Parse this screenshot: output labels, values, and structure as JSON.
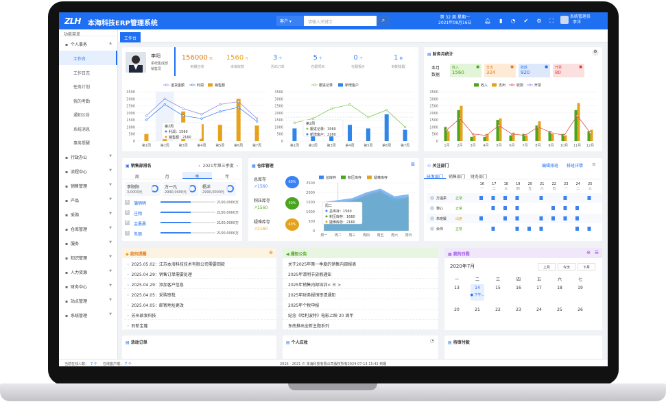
{
  "app": {
    "title": "本海科技ERP管理系统",
    "logo": "ZLH"
  },
  "search": {
    "select_label": "客户",
    "placeholder": "请输入关键字",
    "button_icon": "search-icon"
  },
  "header": {
    "week_line": "第 32 周 星期一",
    "date": "2021年08月16日",
    "user_name": "系统管理员",
    "user_sub": "李洋"
  },
  "sidebar": {
    "header": "功能菜单",
    "groups": [
      {
        "label": "个人事务",
        "icon": "person-icon",
        "expanded": true
      },
      {
        "label": "行政办公",
        "icon": "office-icon"
      },
      {
        "label": "流程中心",
        "icon": "flow-icon"
      },
      {
        "label": "销售管理",
        "icon": "sales-icon"
      },
      {
        "label": "产品",
        "icon": "product-icon"
      },
      {
        "label": "采购",
        "icon": "cart-icon"
      },
      {
        "label": "仓库管理",
        "icon": "warehouse-icon"
      },
      {
        "label": "服务",
        "icon": "service-icon"
      },
      {
        "label": "知识管理",
        "icon": "book-icon"
      },
      {
        "label": "人力资源",
        "icon": "people-icon"
      },
      {
        "label": "财务中心",
        "icon": "money-icon"
      },
      {
        "label": "站点管理",
        "icon": "site-icon"
      },
      {
        "label": "系统管理",
        "icon": "gear-icon"
      }
    ],
    "subitems": [
      "工作台",
      "工作日志",
      "任务计划",
      "我的考勤",
      "通知公告",
      "系统消息",
      "事务提醒"
    ]
  },
  "tabs": [
    "工作台"
  ],
  "profile": {
    "name": "李阳",
    "dept": "系统集成部",
    "role": "销售员"
  },
  "stats": [
    {
      "value": "156000",
      "unit": "元",
      "label": "到期应收",
      "color": "#e57a18"
    },
    {
      "value": "1560",
      "unit": "元",
      "label": "未销收款",
      "color": "#e5a21c"
    },
    {
      "value": "3",
      "unit": "个",
      "label": "活动订单",
      "color": "#3a82f4"
    },
    {
      "value": "5",
      "unit": "个",
      "label": "在跟项目",
      "color": "#3a82f4"
    },
    {
      "value": "0",
      "unit": "个",
      "label": "在跟报价",
      "color": "#3a82f4"
    },
    {
      "value": "1",
      "unit": "条",
      "label": "到期提醒",
      "color": "#3a82f4"
    }
  ],
  "chart_left": {
    "legend": [
      "退货金额",
      "利润",
      "销售额"
    ],
    "categories": [
      "第1周",
      "第2周",
      "第3周",
      "第4周",
      "第5周",
      "第6周",
      "第7周"
    ],
    "ylim": [
      0,
      3500
    ],
    "yticks": [
      0,
      500,
      1000,
      1500,
      2000,
      2500,
      3000,
      3500
    ],
    "bars": [
      500,
      1000,
      2100,
      1200,
      1150,
      3000,
      1100
    ],
    "line1": [
      1800,
      3000,
      2300,
      1900,
      2600,
      2800,
      1600
    ],
    "line2": [
      1500,
      2600,
      1800,
      1600,
      2100,
      2400,
      1400
    ],
    "tooltip": {
      "title": "第2周",
      "rows": [
        "利润：1560",
        "销售额：2160"
      ]
    }
  },
  "chart_mid": {
    "legend": [
      "跟进记录",
      "新增客户"
    ],
    "categories": [
      "第1周",
      "第2周",
      "第3周",
      "第4周",
      "第5周",
      "第6周",
      "第7周"
    ],
    "ylim": [
      0,
      3500
    ],
    "yticks": [
      0,
      500,
      1000,
      1500,
      2000,
      2500,
      3000,
      3500
    ],
    "bars": [
      900,
      1100,
      1400,
      1150,
      900,
      1900,
      800
    ],
    "line": [
      1300,
      1600,
      2300,
      2600,
      1700,
      2200,
      1000
    ],
    "tooltip": {
      "title": "第2周",
      "rows": [
        "跟进记录：1560",
        "新增客户：2160"
      ]
    }
  },
  "finance": {
    "title": "财务月统计",
    "period": [
      "本月",
      "数据"
    ],
    "kpis": [
      {
        "label": "收入",
        "value": "1560",
        "color": "#49a51d",
        "bg": "#e3f5d8"
      },
      {
        "label": "支出",
        "value": "324",
        "color": "#e57a18",
        "bg": "#fdebd7"
      },
      {
        "label": "收款",
        "value": "920",
        "color": "#1e6ff2",
        "bg": "#dde8fb"
      },
      {
        "label": "开票",
        "value": "80",
        "color": "#e23b3b",
        "bg": "#fbe0e0"
      }
    ],
    "legend": [
      "收入",
      "支出",
      "收款",
      "开票"
    ],
    "categories": [
      "1月",
      "2月",
      "3月",
      "4月",
      "5月",
      "6月",
      "7月",
      "8月",
      "9月",
      "10月",
      "11月",
      "12月"
    ],
    "ylim": [
      0,
      3500
    ],
    "yticks": [
      0,
      500,
      1000,
      1500,
      2000,
      2500,
      3000,
      3500
    ],
    "income": [
      1000,
      2200,
      300,
      300,
      1500,
      400,
      500,
      1100,
      700,
      500,
      2200,
      700
    ],
    "expense": [
      700,
      2500,
      400,
      500,
      1600,
      600,
      400,
      1400,
      500,
      400,
      2700,
      800
    ],
    "collect": [
      800,
      1600,
      500,
      400,
      1100,
      500,
      400,
      1000,
      600,
      400,
      1800,
      600
    ]
  },
  "sales_rank": {
    "title": "销售部排名",
    "year": "2021年第三季度",
    "tabs": [
      "周",
      "月",
      "季",
      "年"
    ],
    "active_tab": "季",
    "top": [
      {
        "name": "李阳阳",
        "value": "3,0000元"
      },
      {
        "name": "方一凡",
        "value": "2990,0000元"
      },
      {
        "name": "杨洋",
        "value": "2990,0000元"
      }
    ],
    "rows": [
      {
        "rank": "4",
        "name": "蒲明明",
        "value": "2100,0000万",
        "pct": 0.55
      },
      {
        "rank": "5",
        "name": "庄翔",
        "value": "2100,0000万",
        "pct": 0.55
      },
      {
        "rank": "6",
        "name": "金晨晨",
        "value": "2100,0000万",
        "pct": 0.55
      },
      {
        "rank": "7",
        "name": "朱丽",
        "value": "2100,0000万",
        "pct": 0.55
      }
    ]
  },
  "warehouse": {
    "title": "仓库管理",
    "items": [
      {
        "label": "总库存",
        "value": "1560",
        "pct": "60%",
        "color": "#3a82f4"
      },
      {
        "label": "积压库存",
        "value": "1560",
        "pct": "30%",
        "color": "#49a51d"
      },
      {
        "label": "疑难库存",
        "value": "2160",
        "pct": "40%",
        "color": "#e5a21c"
      }
    ],
    "legend": [
      "总库存",
      "积压库存",
      "疑难库存"
    ],
    "categories": [
      "周一",
      "周二",
      "周三",
      "周四",
      "周五",
      "周六",
      "周日"
    ],
    "ylim": [
      0,
      2500
    ],
    "yticks": [
      0,
      500,
      1000,
      1500,
      2000,
      2500
    ],
    "total": [
      1500,
      1600,
      1700,
      2000,
      2200,
      1800,
      1900
    ],
    "overstock": [
      1300,
      1400,
      1600,
      1800,
      2000,
      1700,
      1700
    ],
    "difficult": [
      1400,
      1500,
      1500,
      1900,
      2100,
      1500,
      1800
    ],
    "tooltip": {
      "title": "周二",
      "rows": [
        "总库存：1560",
        "积压库存：1660",
        "疑难库存：2160"
      ]
    }
  },
  "follow": {
    "title": "关注部门",
    "edit": "编辑排班",
    "detail": "排班详情",
    "tabs": [
      "研发部门",
      "销售部门",
      "财务部门"
    ],
    "days": [
      "16",
      "17",
      "18",
      "19",
      "20",
      "21",
      "22",
      "23",
      "24",
      "25"
    ],
    "weekdays": [
      "一",
      "二",
      "三",
      "四",
      "五",
      "六",
      "日",
      "一",
      "二",
      "三"
    ],
    "people": [
      {
        "name": "万温柔",
        "status": "正常",
        "color": "#49a51d"
      },
      {
        "name": "黎心",
        "status": "正常",
        "color": "#49a51d"
      },
      {
        "name": "朱晓媛",
        "status": "出差",
        "color": "#e5a21c"
      },
      {
        "name": "余伟",
        "status": "正常",
        "color": "#49a51d"
      }
    ]
  },
  "reminders": {
    "title": "我的提醒",
    "items": [
      "2025.05.02：江苏本海科技技术有限公司需要回款",
      "2025.04.29：销售订单需要处理",
      "2025.04.29：添加客户信息",
      "2025.04.05：采购审批",
      "2025.04.05：邮寄地址更改",
      "苏州颖发科技",
      "石新宝隆"
    ]
  },
  "notices": {
    "title": "通知公告",
    "items": [
      "关于2025年第一季度的销售内部报表",
      "2025年清明节放假通知",
      "2025年销售内部培训< 三 >",
      "2025年财务报销审请通知",
      "2025年个税申报",
      "纪念《哈利波特》电影上映 20 周年",
      "东南推出全新主题系列"
    ]
  },
  "schedule": {
    "title": "我的日程",
    "month": "2020年7月",
    "buttons": [
      "上月",
      "今天",
      "下月"
    ],
    "weekdays": [
      "一",
      "二",
      "三",
      "四",
      "五",
      "六",
      "七"
    ],
    "row1": [
      "13",
      "14",
      "15",
      "16",
      "17",
      "18",
      "19"
    ],
    "row2": [
      "20",
      "21",
      "22",
      "23",
      "24",
      "25",
      "26"
    ],
    "event": "下午..."
  },
  "bottom_cards": [
    {
      "title": "活动订单"
    },
    {
      "title": "个人应收"
    },
    {
      "title": "待审付款"
    }
  ],
  "footer": {
    "online": "当前在线人数：",
    "online_count": "7 个",
    "visitors": "在线客户端：",
    "visitors_count": "7 个",
    "copyright": "2016 - 2021 © 本海科技有限公司版权所有2024-07-13 15:42 到期"
  }
}
